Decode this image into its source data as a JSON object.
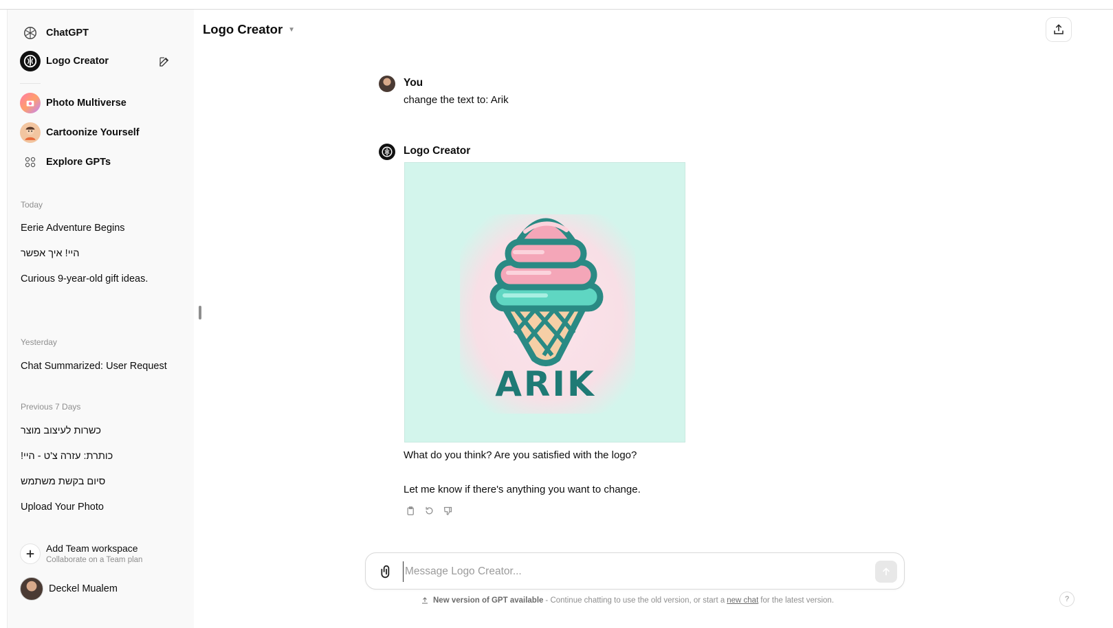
{
  "sidebar": {
    "top": [
      {
        "label": "ChatGPT",
        "icon": "openai-logo-icon"
      },
      {
        "label": "Logo Creator",
        "icon": "logo-creator-avatar-icon"
      }
    ],
    "gpts": [
      {
        "label": "Photo Multiverse",
        "icon": "photo-multiverse-avatar-icon"
      },
      {
        "label": "Cartoonize Yourself",
        "icon": "cartoonize-avatar-icon"
      },
      {
        "label": "Explore GPTs",
        "icon": "grid-icon"
      }
    ],
    "sections": [
      {
        "title": "Today",
        "items": [
          "Eerie Adventure Begins",
          "היי! איך אפשר",
          "Curious 9-year-old gift ideas."
        ]
      },
      {
        "title": "Yesterday",
        "items": [
          "Chat Summarized: User Request"
        ]
      },
      {
        "title": "Previous 7 Days",
        "items": [
          "כשרות לעיצוב מוצר",
          "כותרת: עזרה צ'ט - היי!",
          "סיום בקשת משתמש",
          "Upload Your Photo"
        ]
      }
    ],
    "team": {
      "title": "Add Team workspace",
      "subtitle": "Collaborate on a Team plan"
    },
    "user": {
      "name": "Deckel Mualem"
    }
  },
  "header": {
    "title": "Logo Creator"
  },
  "conversation": {
    "user_msg": {
      "author": "You",
      "text": "change the text to: Arik"
    },
    "bot_msg": {
      "author": "Logo Creator",
      "logo_text": "ARIK",
      "line1": "What do you think? Are you satisfied with the logo?",
      "line2": "Let me know if there's anything you want to change."
    }
  },
  "composer": {
    "placeholder": "Message Logo Creator..."
  },
  "footer": {
    "bold": "New version of GPT available",
    "text_before": "- Continue chatting to use the old version, or start a",
    "link": "new chat",
    "text_after": "for the latest version."
  },
  "help": {
    "label": "?"
  },
  "colors": {
    "accent_teal": "#2a8a84",
    "cone_pink": "#f4a6b8",
    "mint_bg": "#d3f5ec"
  }
}
